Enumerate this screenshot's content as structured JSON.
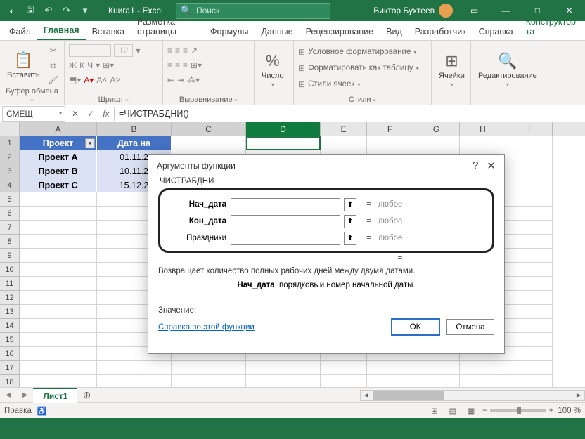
{
  "titlebar": {
    "title": "Книга1 - Excel",
    "search_placeholder": "Поиск",
    "user_name": "Виктор Бухтеев"
  },
  "ribbon": {
    "tabs": [
      "Файл",
      "Главная",
      "Вставка",
      "Разметка страницы",
      "Формулы",
      "Данные",
      "Рецензирование",
      "Вид",
      "Разработчик",
      "Справка",
      "Конструктор та"
    ],
    "active_tab": 1,
    "groups": {
      "clipboard": {
        "label": "Буфер обмена",
        "paste": "Вставить"
      },
      "font": {
        "label": "Шрифт"
      },
      "alignment": {
        "label": "Выравнивание"
      },
      "number": {
        "label": "Число"
      },
      "styles": {
        "label": "Стили",
        "conditional": "Условное форматирование",
        "table": "Форматировать как таблицу",
        "cell_styles": "Стили ячеек"
      },
      "cells": {
        "label": "Ячейки"
      },
      "editing": {
        "label": "Редактирование"
      }
    }
  },
  "formula_bar": {
    "name_box": "СМЕЩ",
    "formula": "=ЧИСТРАБДНИ()"
  },
  "grid": {
    "columns": [
      "A",
      "B",
      "C",
      "D",
      "E",
      "F",
      "G",
      "H",
      "I"
    ],
    "active_col": "D",
    "headers": {
      "A": "Проект",
      "B": "Дата на"
    },
    "rows": [
      {
        "n": 1,
        "A": "Проект",
        "B": "Дата на",
        "is_header": true
      },
      {
        "n": 2,
        "A": "Проект A",
        "B": "01.11.2"
      },
      {
        "n": 3,
        "A": "Проект B",
        "B": "10.11.2"
      },
      {
        "n": 4,
        "A": "Проект C",
        "B": "15.12.2"
      }
    ]
  },
  "dialog": {
    "title": "Аргументы функции",
    "func_name": "ЧИСТРАБДНИ",
    "args": [
      {
        "label": "Нач_дата",
        "bold": true,
        "value": "",
        "result": "любое"
      },
      {
        "label": "Кон_дата",
        "bold": true,
        "value": "",
        "result": "любое"
      },
      {
        "label": "Праздники",
        "bold": false,
        "value": "",
        "result": "любое"
      }
    ],
    "desc": "Возвращает количество полных рабочих дней между двумя датами.",
    "arg_desc_label": "Нач_дата",
    "arg_desc_text": "порядковый номер начальной даты.",
    "value_label": "Значение:",
    "help_link": "Справка по этой функции",
    "ok": "OK",
    "cancel": "Отмена"
  },
  "sheets": {
    "active": "Лист1"
  },
  "status": {
    "mode": "Правка",
    "zoom": "100 %"
  }
}
